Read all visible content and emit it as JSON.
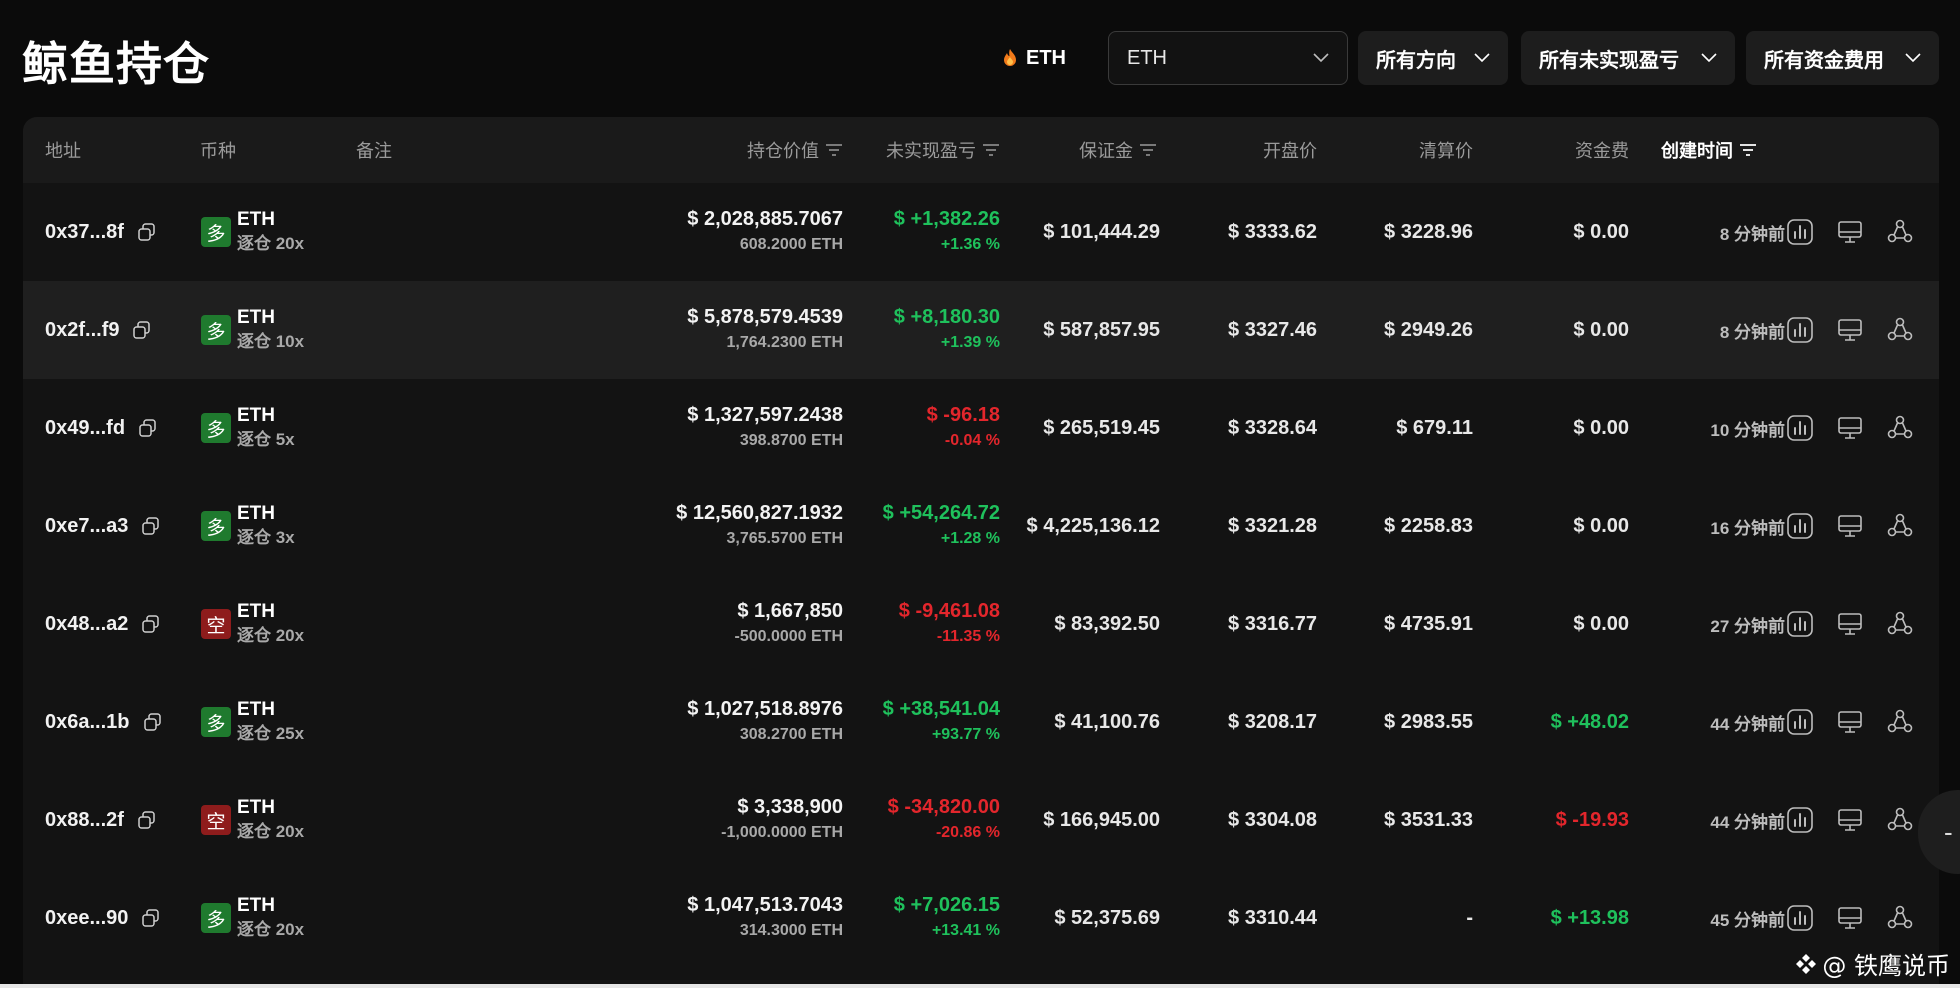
{
  "page": {
    "title": "鲸鱼持仓"
  },
  "toolbar": {
    "token_label": "ETH",
    "token_select_value": "ETH",
    "direction_filter": "所有方向",
    "pnl_filter": "所有未实现盈亏",
    "funding_filter": "所有资金费用"
  },
  "table": {
    "headers": {
      "address": "地址",
      "coin": "币种",
      "note": "备注",
      "position_value": "持仓价值",
      "unrealized_pnl": "未实现盈亏",
      "margin": "保证金",
      "entry_price": "开盘价",
      "liq_price": "清算价",
      "funding": "资金费",
      "created": "创建时间"
    },
    "rows": [
      {
        "address": "0x37...8f",
        "side": "long",
        "side_label": "多",
        "coin": "ETH",
        "leverage": "逐仓 20x",
        "value": "$ 2,028,885.7067",
        "amount": "608.2000 ETH",
        "pnl": "$ +1,382.26",
        "pnl_pct": "+1.36 %",
        "pnl_sign": "pos",
        "margin": "$ 101,444.29",
        "entry": "$ 3333.62",
        "liq": "$ 3228.96",
        "funding": "$ 0.00",
        "funding_sign": "",
        "created": "8 分钟前"
      },
      {
        "address": "0x2f...f9",
        "side": "long",
        "side_label": "多",
        "coin": "ETH",
        "leverage": "逐仓 10x",
        "value": "$ 5,878,579.4539",
        "amount": "1,764.2300 ETH",
        "pnl": "$ +8,180.30",
        "pnl_pct": "+1.39 %",
        "pnl_sign": "pos",
        "margin": "$ 587,857.95",
        "entry": "$ 3327.46",
        "liq": "$ 2949.26",
        "funding": "$ 0.00",
        "funding_sign": "",
        "created": "8 分钟前"
      },
      {
        "address": "0x49...fd",
        "side": "long",
        "side_label": "多",
        "coin": "ETH",
        "leverage": "逐仓 5x",
        "value": "$ 1,327,597.2438",
        "amount": "398.8700 ETH",
        "pnl": "$ -96.18",
        "pnl_pct": "-0.04 %",
        "pnl_sign": "neg",
        "margin": "$ 265,519.45",
        "entry": "$ 3328.64",
        "liq": "$ 679.11",
        "funding": "$ 0.00",
        "funding_sign": "",
        "created": "10 分钟前"
      },
      {
        "address": "0xe7...a3",
        "side": "long",
        "side_label": "多",
        "coin": "ETH",
        "leverage": "逐仓 3x",
        "value": "$ 12,560,827.1932",
        "amount": "3,765.5700 ETH",
        "pnl": "$ +54,264.72",
        "pnl_pct": "+1.28 %",
        "pnl_sign": "pos",
        "margin": "$ 4,225,136.12",
        "entry": "$ 3321.28",
        "liq": "$ 2258.83",
        "funding": "$ 0.00",
        "funding_sign": "",
        "created": "16 分钟前"
      },
      {
        "address": "0x48...a2",
        "side": "short",
        "side_label": "空",
        "coin": "ETH",
        "leverage": "逐仓 20x",
        "value": "$ 1,667,850",
        "amount": "-500.0000 ETH",
        "pnl": "$ -9,461.08",
        "pnl_pct": "-11.35 %",
        "pnl_sign": "neg",
        "margin": "$ 83,392.50",
        "entry": "$ 3316.77",
        "liq": "$ 4735.91",
        "funding": "$ 0.00",
        "funding_sign": "",
        "created": "27 分钟前"
      },
      {
        "address": "0x6a...1b",
        "side": "long",
        "side_label": "多",
        "coin": "ETH",
        "leverage": "逐仓 25x",
        "value": "$ 1,027,518.8976",
        "amount": "308.2700 ETH",
        "pnl": "$ +38,541.04",
        "pnl_pct": "+93.77 %",
        "pnl_sign": "pos",
        "margin": "$ 41,100.76",
        "entry": "$ 3208.17",
        "liq": "$ 2983.55",
        "funding": "$ +48.02",
        "funding_sign": "pos",
        "created": "44 分钟前"
      },
      {
        "address": "0x88...2f",
        "side": "short",
        "side_label": "空",
        "coin": "ETH",
        "leverage": "逐仓 20x",
        "value": "$ 3,338,900",
        "amount": "-1,000.0000 ETH",
        "pnl": "$ -34,820.00",
        "pnl_pct": "-20.86 %",
        "pnl_sign": "neg",
        "margin": "$ 166,945.00",
        "entry": "$ 3304.08",
        "liq": "$ 3531.33",
        "funding": "$ -19.93",
        "funding_sign": "neg",
        "created": "44 分钟前"
      },
      {
        "address": "0xee...90",
        "side": "long",
        "side_label": "多",
        "coin": "ETH",
        "leverage": "逐仓 20x",
        "value": "$ 1,047,513.7043",
        "amount": "314.3000 ETH",
        "pnl": "$ +7,026.15",
        "pnl_pct": "+13.41 %",
        "pnl_sign": "pos",
        "margin": "$ 52,375.69",
        "entry": "$ 3310.44",
        "liq": "-",
        "funding": "$ +13.98",
        "funding_sign": "pos",
        "created": "45 分钟前"
      }
    ]
  },
  "watermark": {
    "text": "@ 铁鹰说币"
  },
  "colors": {
    "positive": "#1fc15c",
    "negative": "#e3262c",
    "long_badge": "#1f7a2e",
    "short_badge": "#8e1c1c"
  },
  "icons": {
    "flame": "flame-icon",
    "chevron": "chevron-down-icon",
    "sort": "sort-icon",
    "copy": "copy-icon",
    "chart": "bar-chart-icon",
    "monitor": "monitor-icon",
    "network": "share-network-icon"
  }
}
